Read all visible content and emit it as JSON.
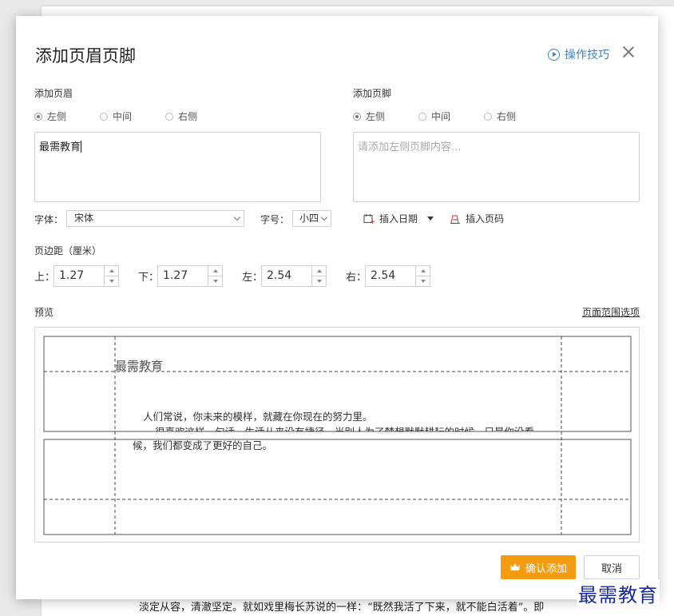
{
  "document": {
    "bottom_text": "淡定从容，清澈坚定。就如戏里梅长苏说的一样：“既然我活了下来，就不能白活着”。即",
    "watermark": "最需教育"
  },
  "dialog": {
    "title": "添加页眉页脚",
    "tips_label": "操作技巧",
    "header": {
      "label": "添加页眉",
      "options": [
        "左侧",
        "中间",
        "右侧"
      ],
      "selected": "左侧",
      "content": "最需教育"
    },
    "footer": {
      "label": "添加页脚",
      "options": [
        "左侧",
        "中间",
        "右侧"
      ],
      "selected": "左侧",
      "placeholder": "请添加左侧页脚内容..."
    },
    "font": {
      "label": "字体：",
      "value": "宋体"
    },
    "size": {
      "label": "字号：",
      "value": "小四"
    },
    "insert_date_label": "插入日期",
    "insert_page_label": "插入页码",
    "margins": {
      "label": "页边距（厘米）",
      "top": {
        "label": "上：",
        "value": "1.27"
      },
      "bottom": {
        "label": "下：",
        "value": "1.27"
      },
      "left": {
        "label": "左：",
        "value": "2.54"
      },
      "right": {
        "label": "右：",
        "value": "2.54"
      }
    },
    "preview": {
      "label": "预览",
      "range_link": "页面范围选项",
      "header_text": "最需教育",
      "line1": "人们常说，你未来的模样，就藏在你现在的努力里。",
      "line2": "很喜欢这样一句话，生活从来没有捷径，当别人为了梦想默默耕耘的时候，只是你没看",
      "line3": "候，我们都变成了更好的自己。"
    },
    "confirm_label": "确认添加",
    "cancel_label": "取消"
  },
  "colors": {
    "accent": "#f39c12",
    "link": "#3b82c4"
  }
}
